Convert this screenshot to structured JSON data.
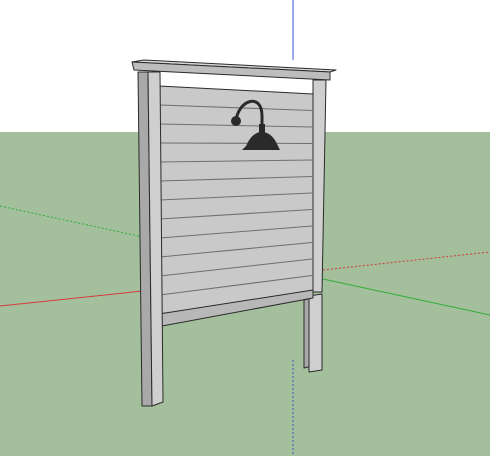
{
  "scene": {
    "sky_color": "#ffffff",
    "ground_color": "#a3bf9b",
    "axis_colors": {
      "blue_z": "#3b57d9",
      "red_x": "#d43b3b",
      "green_y": "#2fae35"
    },
    "wall_colors": {
      "face": "#c9c9c9",
      "face_shadow": "#b8b8b8",
      "post_front": "#cfcfcf",
      "post_side": "#a9a9a9",
      "board_line": "#6f6f6f",
      "edge": "#2b2b2b",
      "cap_top": "#d8d8d8",
      "cap_front": "#bdbdbd"
    },
    "lamp": {
      "name": "gooseneck-barn-light",
      "color": "#2a2a2a"
    },
    "wall": {
      "name": "outdoor-shower-wall",
      "board_count": 12
    }
  }
}
